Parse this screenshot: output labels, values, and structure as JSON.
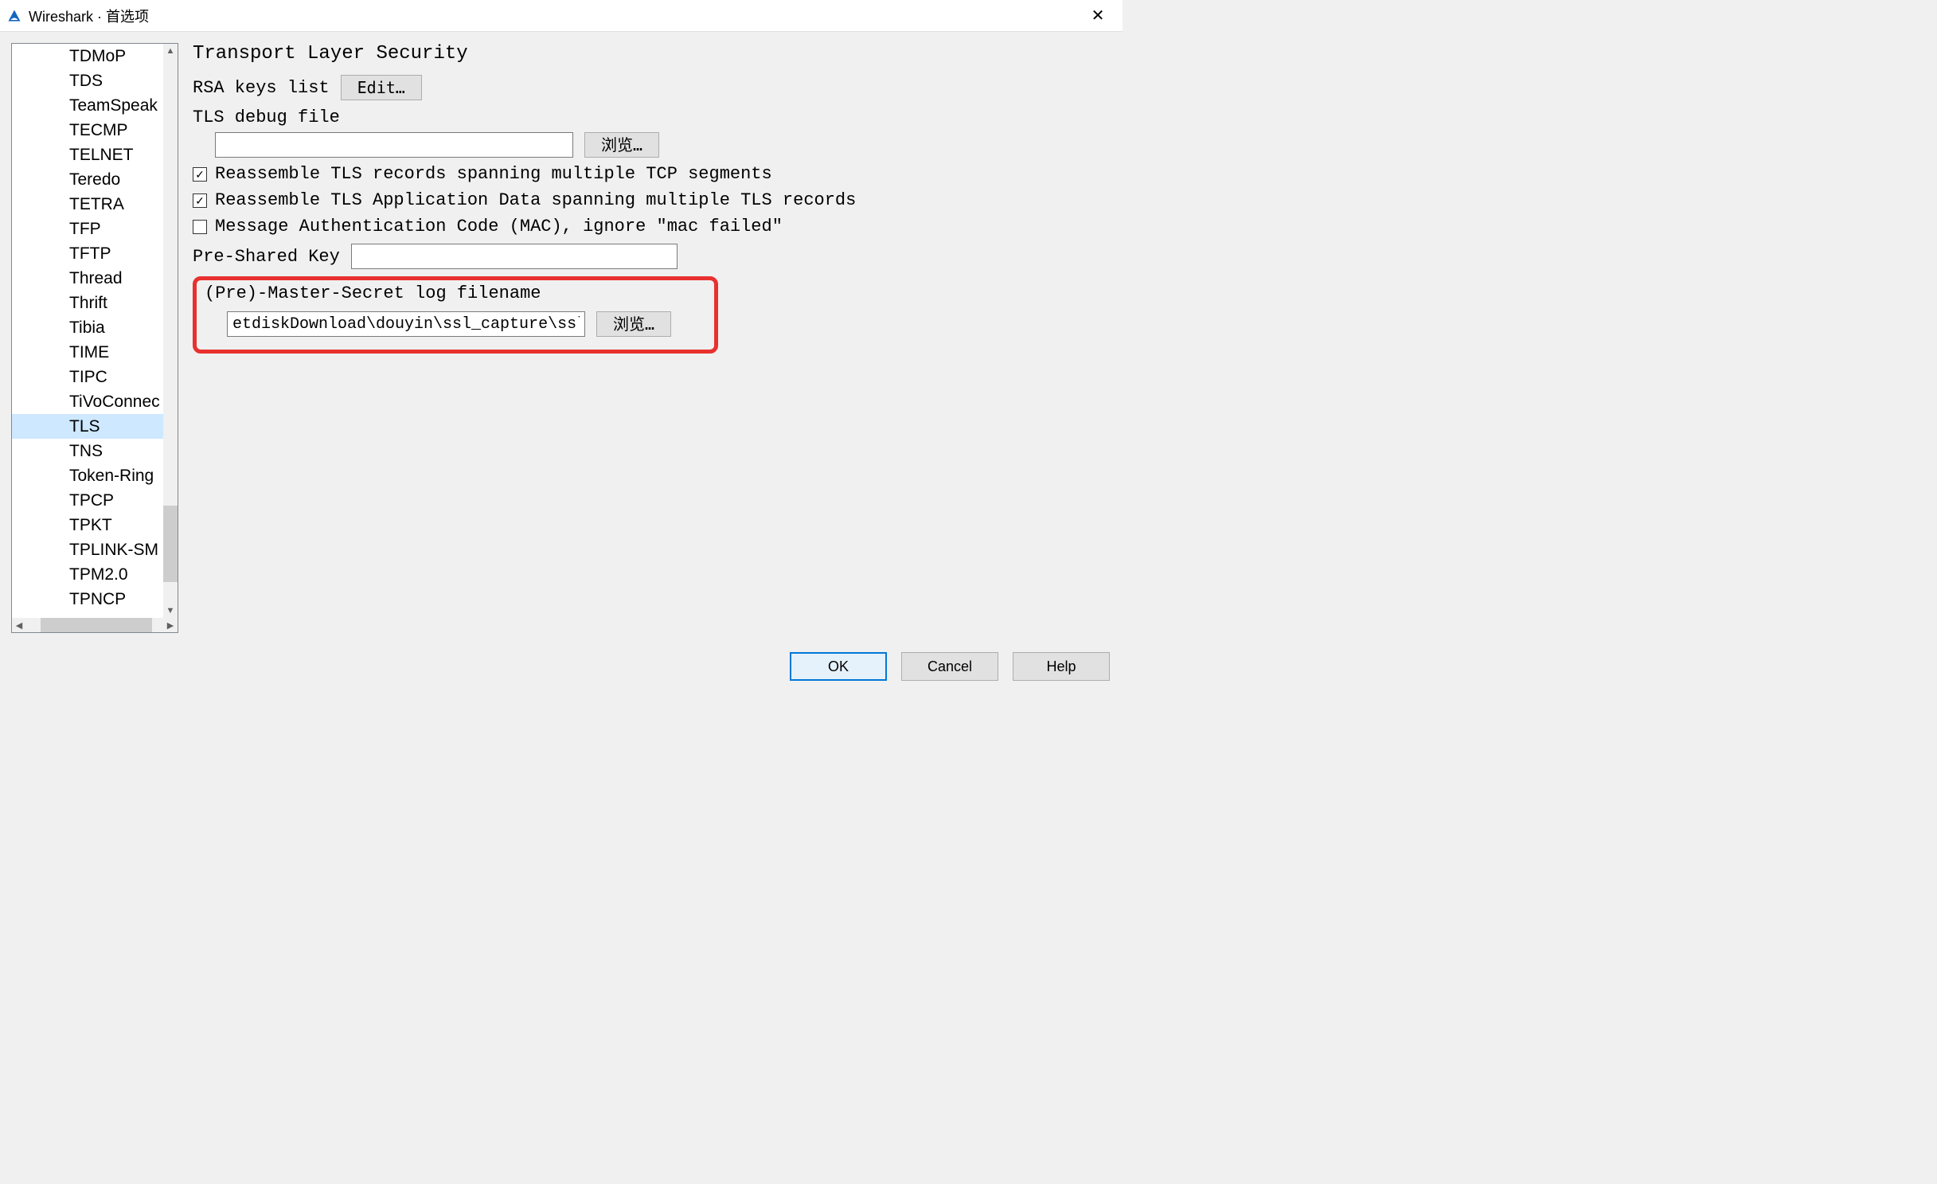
{
  "title": "Wireshark · 首选项",
  "sidebar": {
    "items": [
      "TDMoP",
      "TDS",
      "TeamSpeak",
      "TECMP",
      "TELNET",
      "Teredo",
      "TETRA",
      "TFP",
      "TFTP",
      "Thread",
      "Thrift",
      "Tibia",
      "TIME",
      "TIPC",
      "TiVoConnec",
      "TLS",
      "TNS",
      "Token-Ring",
      "TPCP",
      "TPKT",
      "TPLINK-SM",
      "TPM2.0",
      "TPNCP"
    ],
    "selected": "TLS"
  },
  "main": {
    "heading": "Transport Layer Security",
    "rsa_label": "RSA keys list",
    "edit_button": "Edit…",
    "debug_label": "TLS debug file",
    "debug_value": "",
    "debug_browse": "浏览…",
    "cb1_label": "Reassemble TLS records spanning multiple TCP segments",
    "cb1_checked": true,
    "cb2_label": "Reassemble TLS Application Data spanning multiple TLS records",
    "cb2_checked": true,
    "cb3_label": "Message Authentication Code (MAC), ignore \"mac failed\"",
    "cb3_checked": false,
    "psk_label": "Pre-Shared Key",
    "psk_value": "",
    "pms_label": "(Pre)-Master-Secret log filename",
    "pms_value": "etdiskDownload\\douyin\\ssl_capture\\sslkey.txt",
    "pms_browse": "浏览…"
  },
  "buttons": {
    "ok": "OK",
    "cancel": "Cancel",
    "help": "Help"
  }
}
